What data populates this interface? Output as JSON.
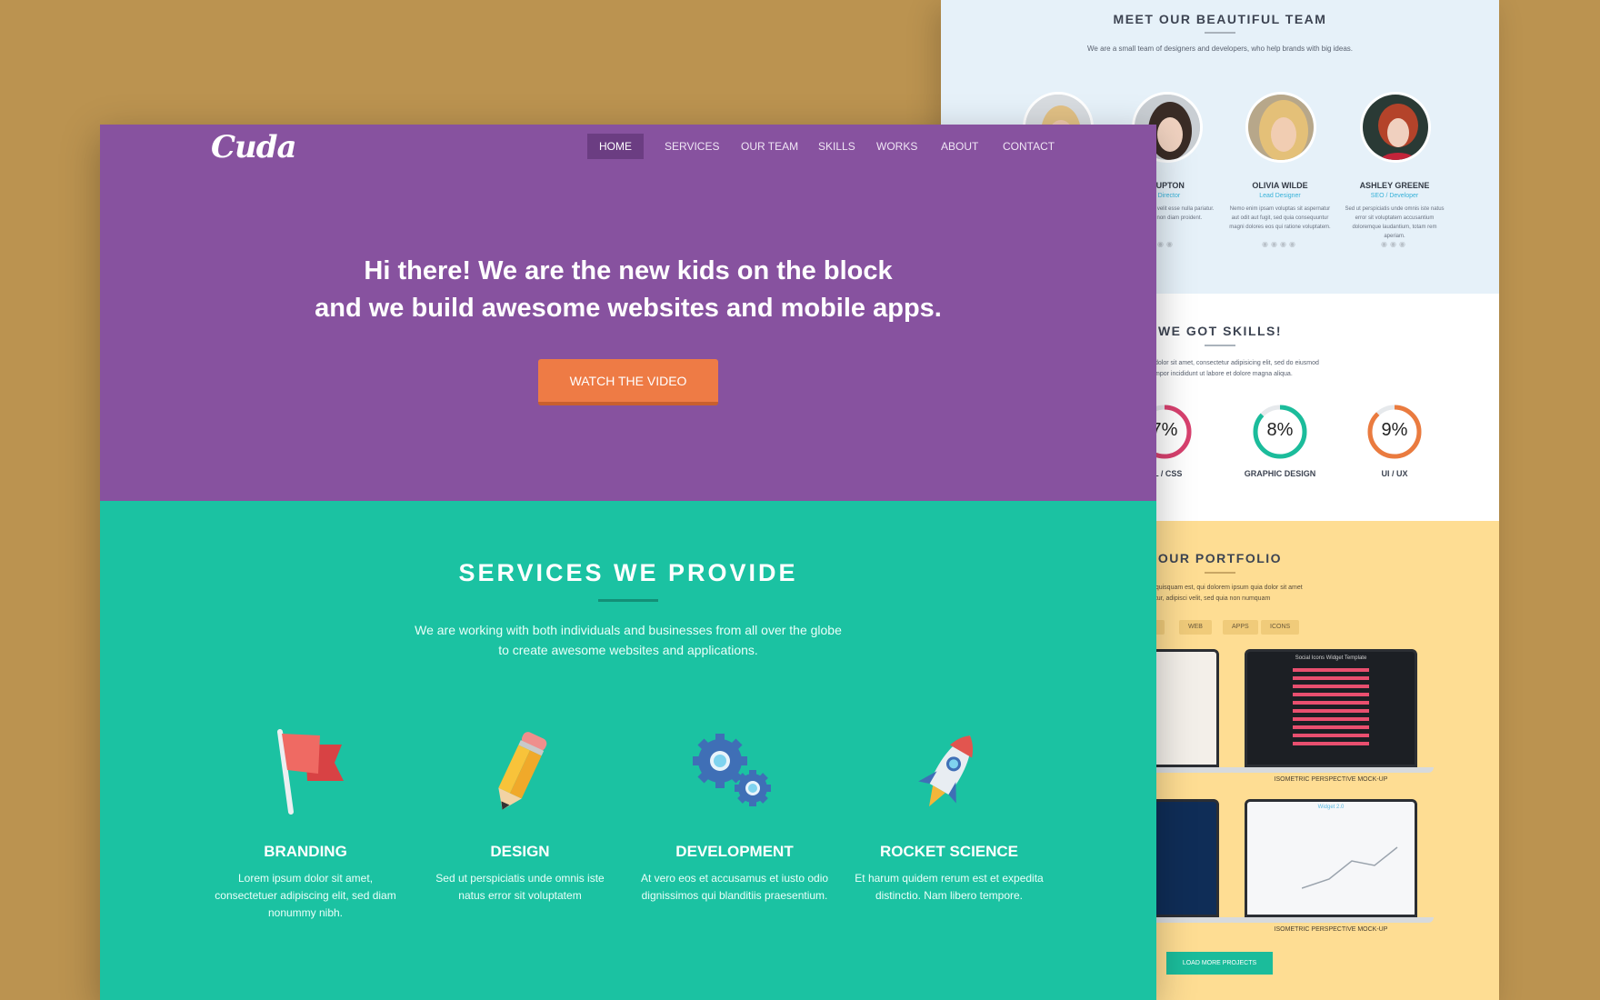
{
  "back": {
    "team": {
      "title": "MEET OUR BEAUTIFUL TEAM",
      "subtitle": "We are a small team of designers and developers, who help brands with big ideas.",
      "members": [
        {
          "name": "",
          "role": "",
          "bio": ""
        },
        {
          "name": "E UPTON",
          "role": "e Director",
          "bio": "r in in voluptate velit esse nulla pariatur. Excepteur non diam proident."
        },
        {
          "name": "OLIVIA WILDE",
          "role": "Lead Designer",
          "bio": "Nemo enim ipsam voluptas sit aspernatur aut odit aut fugit, sed quia consequuntur magni dolores eos qui ratione voluptatem."
        },
        {
          "name": "ASHLEY GREENE",
          "role": "SEO / Developer",
          "bio": "Sed ut perspiciatis unde omnis iste natus error sit voluptatem accusantium doloremque laudantium, totam rem aperiam."
        }
      ]
    },
    "skills": {
      "title": "WE GOT SKILLS!",
      "subtitle_line1": "dolor sit amet, consectetur adipisicing elit, sed do eiusmod",
      "subtitle_line2": "mpor incididunt ut labore et dolore magna aliqua.",
      "items": [
        {
          "value_text": "7%",
          "label": "ML / CSS",
          "fraction": 0.87,
          "color": "#d9416f"
        },
        {
          "value_text": "8%",
          "label": "GRAPHIC DESIGN",
          "fraction": 0.87,
          "color": "#1bbc9b"
        },
        {
          "value_text": "9%",
          "label": "UI / UX",
          "fraction": 0.88,
          "color": "#ea7b3f"
        }
      ]
    },
    "portfolio": {
      "title": "OUR PORTFOLIO",
      "subtitle_line1": "o quisquam est, qui dolorem ipsum quia dolor sit amet",
      "subtitle_line2": "tetur, adipisci velit, sed quia non numquam",
      "filters": [
        "LL",
        "WEB",
        "APPS",
        "ICONS"
      ],
      "projects": [
        {
          "label": "P"
        },
        {
          "label": "ISOMETRIC PERSPECTIVE MOCK-UP",
          "screen_title": "Social Icons Widget Template"
        },
        {
          "label": "P"
        },
        {
          "label": "ISOMETRIC PERSPECTIVE MOCK-UP",
          "screen_title": "Widget 2.0"
        }
      ],
      "load_more": "LOAD MORE PROJECTS"
    }
  },
  "front": {
    "logo": "Cuda",
    "nav": [
      "HOME",
      "SERVICES",
      "OUR TEAM",
      "SKILLS",
      "WORKS",
      "ABOUT",
      "CONTACT"
    ],
    "hero": {
      "line1": "Hi there! We are the new kids on the block",
      "line2": "and we build awesome websites and mobile apps.",
      "cta": "WATCH THE VIDEO"
    },
    "services": {
      "title": "SERVICES WE PROVIDE",
      "subtitle": "We are working with both individuals and businesses from all over the globe to create awesome websites and applications.",
      "items": [
        {
          "name": "BRANDING",
          "icon": "flag-icon",
          "desc": "Lorem ipsum dolor sit amet, consectetuer adipiscing elit, sed diam nonummy nibh."
        },
        {
          "name": "DESIGN",
          "icon": "pencil-icon",
          "desc": "Sed ut perspiciatis unde omnis iste natus error sit voluptatem"
        },
        {
          "name": "DEVELOPMENT",
          "icon": "gears-icon",
          "desc": "At vero eos et accusamus et iusto odio dignissimos qui blanditiis praesentium."
        },
        {
          "name": "ROCKET SCIENCE",
          "icon": "rocket-icon",
          "desc": "Et harum quidem rerum est et expedita distinctio. Nam libero tempore."
        }
      ]
    }
  },
  "colors": {
    "background": "#bb9350",
    "hero": "#87529f",
    "services": "#1bc2a2",
    "cta": "#ee7b45",
    "portfolio": "#fedd93",
    "team": "#e6f1f9"
  }
}
